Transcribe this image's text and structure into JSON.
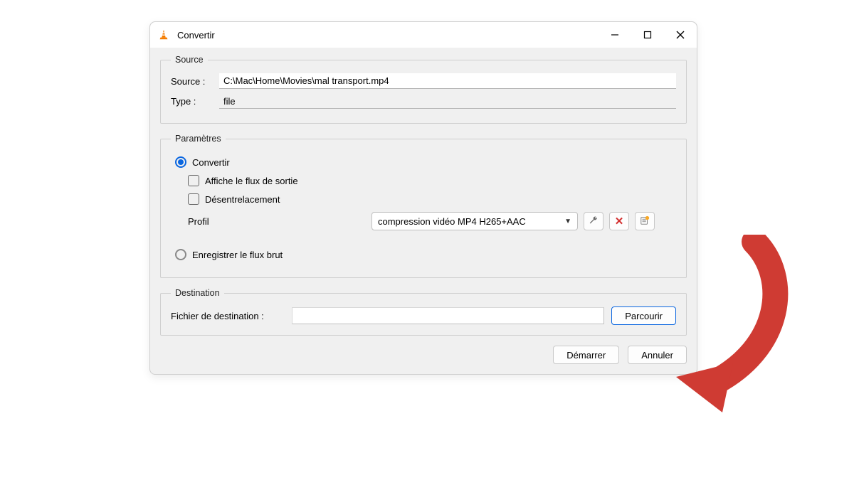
{
  "window": {
    "title": "Convertir"
  },
  "source_group": {
    "legend": "Source",
    "source_label": "Source :",
    "source_value": "C:\\Mac\\Home\\Movies\\mal transport.mp4",
    "type_label": "Type :",
    "type_value": "file"
  },
  "params_group": {
    "legend": "Paramètres",
    "radio_convertir": "Convertir",
    "chk_flux_sortie": "Affiche le flux de sortie",
    "chk_desentrelacement": "Désentrelacement",
    "profil_label": "Profil",
    "profil_value": "compression vidéo MP4 H265+AAC",
    "radio_flux_brut": "Enregistrer le flux brut"
  },
  "dest_group": {
    "legend": "Destination",
    "dest_label": "Fichier de destination :",
    "dest_value": "",
    "browse_label": "Parcourir"
  },
  "footer": {
    "start_label": "Démarrer",
    "cancel_label": "Annuler"
  },
  "colors": {
    "accent": "#0a66e0",
    "annotation": "#cf3b33"
  }
}
